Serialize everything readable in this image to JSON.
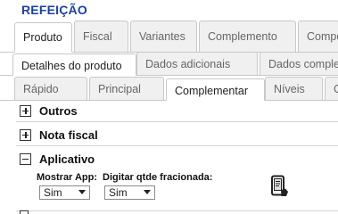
{
  "page_title": "REFEIÇÃO",
  "main_tabs": [
    {
      "label": "Produto",
      "active": true
    },
    {
      "label": "Fiscal",
      "active": false
    },
    {
      "label": "Variantes",
      "active": false
    },
    {
      "label": "Complemento",
      "active": false
    },
    {
      "label": "Compo",
      "active": false
    }
  ],
  "sub_tabs": [
    {
      "label": "Detalhes do produto",
      "active": true
    },
    {
      "label": "Dados adicionais",
      "active": false
    },
    {
      "label": "Dados complem",
      "active": false
    }
  ],
  "detail_tabs": [
    {
      "label": "Rápido",
      "active": false
    },
    {
      "label": "Principal",
      "active": false
    },
    {
      "label": "Complementar",
      "active": true
    },
    {
      "label": "Níveis",
      "active": false
    },
    {
      "label": "C",
      "active": false
    }
  ],
  "sections": [
    {
      "label": "Outros",
      "expanded": false
    },
    {
      "label": "Nota fiscal",
      "expanded": false
    },
    {
      "label": "Aplicativo",
      "expanded": true
    }
  ],
  "aplicativo": {
    "mostrar_app": {
      "label": "Mostrar App:",
      "value": "Sim"
    },
    "digitar_qtde": {
      "label": "Digitar qtde fracionada:",
      "value": "Sim"
    }
  },
  "colors": {
    "title": "#1a3fae",
    "tab_border": "#c8c8c8",
    "inactive_tab_bg": "#f0f0f0"
  },
  "icons": {
    "app": "mobile-phone-icon"
  }
}
